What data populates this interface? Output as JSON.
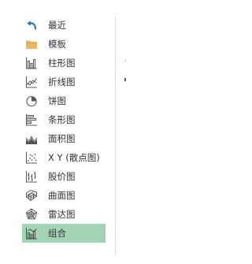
{
  "sidebar": {
    "items": [
      {
        "label": "最近",
        "icon": "recent-undo-arrow-icon",
        "selected": false
      },
      {
        "label": "模板",
        "icon": "folder-icon",
        "selected": false
      },
      {
        "label": "柱形图",
        "icon": "column-chart-icon",
        "selected": false
      },
      {
        "label": "折线图",
        "icon": "line-chart-icon",
        "selected": false
      },
      {
        "label": "饼图",
        "icon": "pie-chart-icon",
        "selected": false
      },
      {
        "label": "条形图",
        "icon": "bar-chart-icon",
        "selected": false
      },
      {
        "label": "面积图",
        "icon": "area-chart-icon",
        "selected": false
      },
      {
        "label": "X Y (散点图)",
        "icon": "scatter-chart-icon",
        "selected": false
      },
      {
        "label": "股价图",
        "icon": "stock-chart-icon",
        "selected": false
      },
      {
        "label": "曲面图",
        "icon": "surface-chart-icon",
        "selected": false
      },
      {
        "label": "雷达图",
        "icon": "radar-chart-icon",
        "selected": false
      },
      {
        "label": "组合",
        "icon": "combo-chart-icon",
        "selected": true
      }
    ]
  },
  "colors": {
    "selected_background": "#a4d4b6",
    "recent_icon": "#2e75b6",
    "folder_icon": "#e8b862",
    "icon_stroke": "#5a5a5a",
    "label_text": "#333333",
    "divider": "#dcdcdc"
  }
}
